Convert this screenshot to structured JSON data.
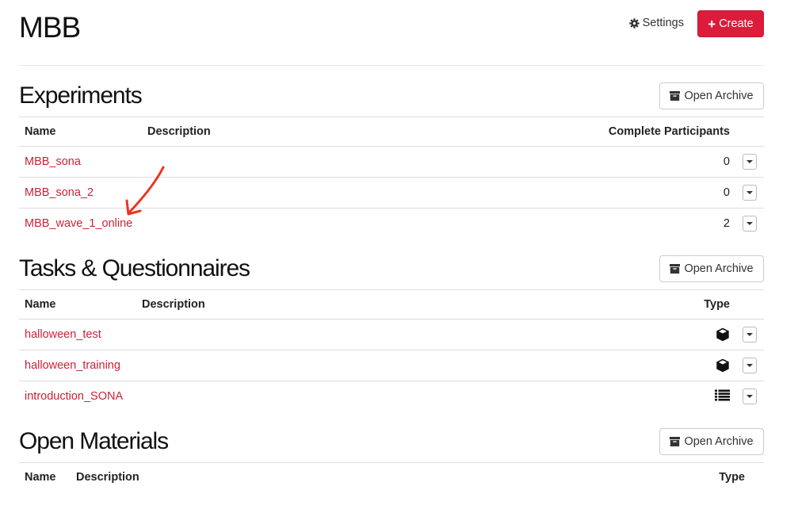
{
  "header": {
    "project_title": "MBB",
    "settings_label": "Settings",
    "create_label": "Create",
    "create_icon": "plus-icon",
    "settings_icon": "gear-icon"
  },
  "colors": {
    "accent": "#dc1c3a",
    "link": "#cc2238",
    "annotation": "#ee3322"
  },
  "experiments": {
    "title": "Experiments",
    "archive_label": "Open Archive",
    "columns": {
      "name": "Name",
      "description": "Description",
      "participants": "Complete Participants"
    },
    "rows": [
      {
        "name": "MBB_sona",
        "participants": "0"
      },
      {
        "name": "MBB_sona_2",
        "participants": "0"
      },
      {
        "name": "MBB_wave_1_online",
        "participants": "2"
      }
    ]
  },
  "tasks": {
    "title": "Tasks & Questionnaires",
    "archive_label": "Open Archive",
    "columns": {
      "name": "Name",
      "description": "Description",
      "type": "Type"
    },
    "rows": [
      {
        "name": "halloween_test",
        "type_icon": "cube-icon"
      },
      {
        "name": "halloween_training",
        "type_icon": "cube-icon"
      },
      {
        "name": "introduction_SONA",
        "type_icon": "list-icon"
      }
    ]
  },
  "materials": {
    "title": "Open Materials",
    "archive_label": "Open Archive",
    "columns": {
      "name": "Name",
      "description": "Description",
      "type": "Type"
    }
  },
  "annotation": {
    "shape": "red-arrow",
    "points_to": "MBB_wave_1_online"
  }
}
